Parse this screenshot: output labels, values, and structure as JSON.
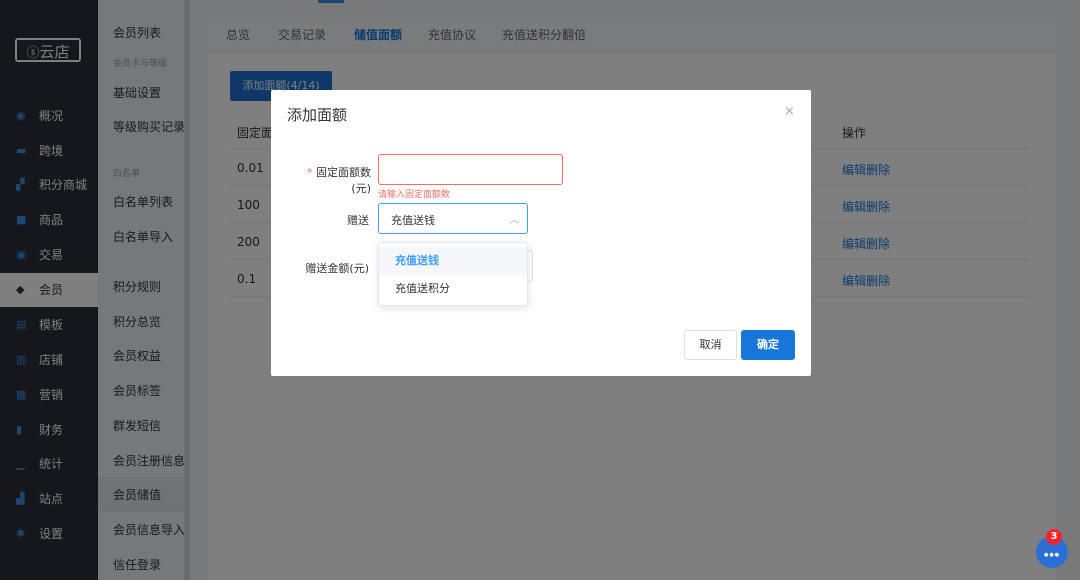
{
  "brand": {
    "logo_text": "云店"
  },
  "nav": {
    "items": [
      {
        "label": "概况",
        "icon": "dashboard-icon"
      },
      {
        "label": "跨境",
        "icon": "globe-icon"
      },
      {
        "label": "积分商城",
        "icon": "points-icon"
      },
      {
        "label": "商品",
        "icon": "bag-icon"
      },
      {
        "label": "交易",
        "icon": "trade-icon"
      },
      {
        "label": "会员",
        "icon": "diamond-icon",
        "active": true
      },
      {
        "label": "模板",
        "icon": "template-icon"
      },
      {
        "label": "店铺",
        "icon": "store-icon"
      },
      {
        "label": "营销",
        "icon": "gift-icon"
      },
      {
        "label": "财务",
        "icon": "finance-icon"
      },
      {
        "label": "统计",
        "icon": "chart-icon"
      },
      {
        "label": "站点",
        "icon": "sitemap-icon"
      },
      {
        "label": "设置",
        "icon": "gear-icon"
      }
    ]
  },
  "subnav": {
    "items": [
      "会员列表",
      "会员卡与等级",
      "基础设置",
      "等级购买记录",
      "白名单",
      "白名单列表",
      "白名单导入",
      "积分规则",
      "积分总览",
      "会员权益",
      "会员标签",
      "群发短信",
      "会员注册信息",
      "会员储值",
      "会员信息导入",
      "信任登录"
    ]
  },
  "tabs": [
    "总览",
    "交易记录",
    "储值面额",
    "充值协议",
    "充值送积分翻倍"
  ],
  "add_button": "添加面额(4/14)",
  "table": {
    "col_amount": "固定面",
    "col_action": "操作",
    "rows": [
      "0.01",
      "100",
      "200",
      "0.1"
    ],
    "action_label": "编辑删除"
  },
  "modal": {
    "title": "添加面额",
    "close": "×",
    "amount_label": "固定面额数(元)",
    "required_mark": "*",
    "amount_value": "",
    "amount_error": "请输入固定面额数",
    "gift_label": "赠送",
    "gift_selected": "充值送钱",
    "gift_options": [
      "充值送钱",
      "充值送积分"
    ],
    "gift_amount_label": "赠送金额(元)",
    "cancel": "取消",
    "confirm": "确定"
  },
  "chat": {
    "badge": "3"
  },
  "colors": {
    "primary": "#1677d9",
    "error": "#f56c6c",
    "nav_bg": "#2b2f3a"
  }
}
